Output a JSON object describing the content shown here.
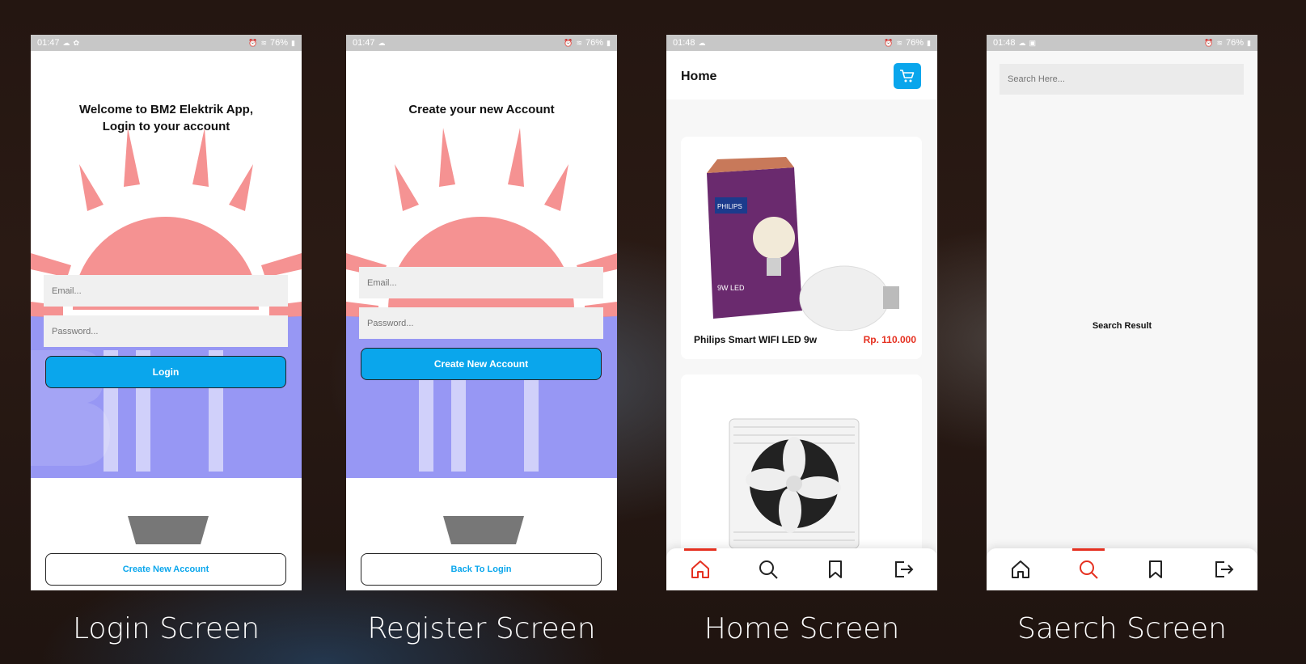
{
  "colors": {
    "accent": "#0aa6ec",
    "active": "#e53020",
    "logo_sun": "#f28b8b",
    "logo_text": "#7b7bf0"
  },
  "phones": {
    "login": {
      "status_time": "01:47",
      "status_battery": "76%",
      "title": "Welcome to BM2 Elektrik App, Login to your account",
      "email_placeholder": "Email...",
      "password_placeholder": "Password...",
      "primary_button": "Login",
      "secondary_button": "Create New Account",
      "caption": "Login Screen"
    },
    "register": {
      "status_time": "01:47",
      "status_battery": "76%",
      "title": "Create your new Account",
      "email_placeholder": "Email...",
      "password_placeholder": "Password...",
      "primary_button": "Create New Account",
      "secondary_button": "Back To Login",
      "caption": "Register Screen"
    },
    "home": {
      "status_time": "01:48",
      "status_battery": "76%",
      "title": "Home",
      "products": [
        {
          "name": "Philips Smart WIFI LED 9w",
          "price": "Rp. 110.000",
          "box_text": "PHILIPS",
          "box_sub": "9W LED"
        },
        {
          "name": "",
          "price": ""
        }
      ],
      "caption": "Home Screen"
    },
    "search": {
      "status_time": "01:48",
      "status_battery": "76%",
      "search_placeholder": "Search Here...",
      "result_text": "Search Result",
      "caption": "Saerch Screen"
    }
  },
  "nav_icons": [
    "home-icon",
    "search-icon",
    "bookmark-icon",
    "logout-icon"
  ]
}
